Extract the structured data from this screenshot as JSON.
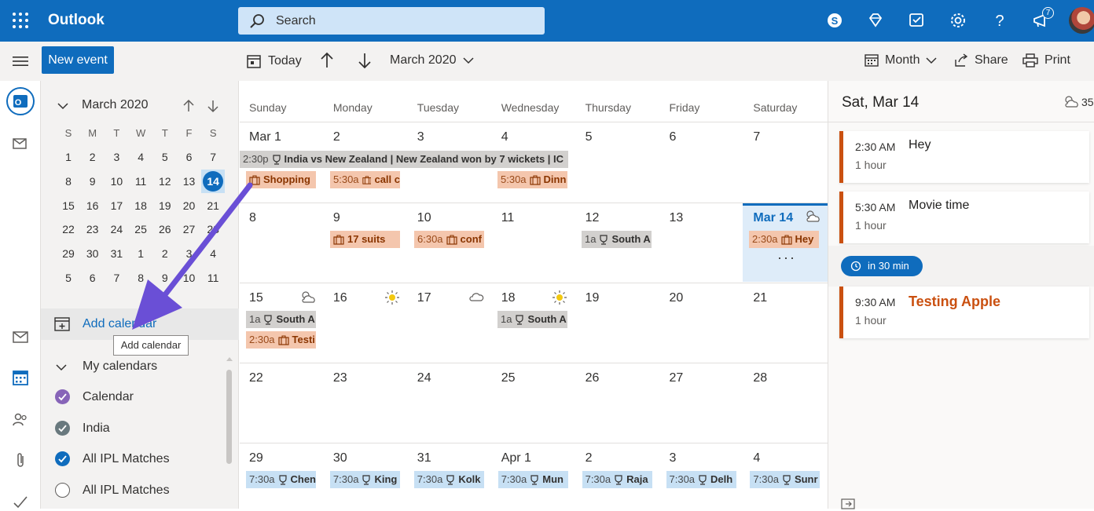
{
  "app": {
    "title": "Outlook"
  },
  "search": {
    "placeholder": "Search"
  },
  "notifications": {
    "count": "7"
  },
  "toolbar": {
    "new_event_label": "New event",
    "today_label": "Today",
    "current_period": "March 2020",
    "view_label": "Month",
    "share_label": "Share",
    "print_label": "Print"
  },
  "mini_calendar": {
    "title": "March 2020",
    "weekday_letters": [
      "S",
      "M",
      "T",
      "W",
      "T",
      "F",
      "S"
    ],
    "weeks": [
      [
        "1",
        "2",
        "3",
        "4",
        "5",
        "6",
        "7"
      ],
      [
        "8",
        "9",
        "10",
        "11",
        "12",
        "13",
        "14"
      ],
      [
        "15",
        "16",
        "17",
        "18",
        "19",
        "20",
        "21"
      ],
      [
        "22",
        "23",
        "24",
        "25",
        "26",
        "27",
        "28"
      ],
      [
        "29",
        "30",
        "31",
        "1",
        "2",
        "3",
        "4"
      ],
      [
        "5",
        "6",
        "7",
        "8",
        "9",
        "10",
        "11"
      ]
    ],
    "selected_day": "14"
  },
  "sidebar": {
    "add_calendar_label": "Add calendar",
    "tooltip": "Add calendar",
    "my_calendars_label": "My calendars",
    "calendars": [
      {
        "name": "Calendar",
        "checked": true,
        "color": "#8764b8"
      },
      {
        "name": "India",
        "checked": true,
        "color": "#69797e"
      },
      {
        "name": "All IPL Matches",
        "checked": true,
        "color": "#0f6cbd"
      },
      {
        "name": "All IPL Matches",
        "checked": false,
        "color": "#605e5c"
      }
    ]
  },
  "month_view": {
    "weekdays": [
      "Sunday",
      "Monday",
      "Tuesday",
      "Wednesday",
      "Thursday",
      "Friday",
      "Saturday"
    ],
    "weeks": [
      [
        "Mar 1",
        "2",
        "3",
        "4",
        "5",
        "6",
        "7"
      ],
      [
        "8",
        "9",
        "10",
        "11",
        "12",
        "13",
        "Mar 14"
      ],
      [
        "15",
        "16",
        "17",
        "18",
        "19",
        "20",
        "21"
      ],
      [
        "22",
        "23",
        "24",
        "25",
        "26",
        "27",
        "28"
      ],
      [
        "29",
        "30",
        "31",
        "Apr 1",
        "2",
        "3",
        "4"
      ]
    ],
    "today_label": "Mar 14",
    "more_indicator": "···",
    "events": {
      "w1_banner": {
        "time": "2:30p",
        "title": "India vs New Zealand | New Zealand won by 7 wickets | IC"
      },
      "w1_sun": {
        "title": "Shopping"
      },
      "w1_mon": {
        "time": "5:30a",
        "title": "call c"
      },
      "w1_wed": {
        "time": "5:30a",
        "title": "Dinn"
      },
      "w2_mon": {
        "title": "17 suits"
      },
      "w2_tue": {
        "time": "6:30a",
        "title": "conf"
      },
      "w2_thu": {
        "time": "1a",
        "title": "South A"
      },
      "w2_sat": {
        "time": "2:30a",
        "title": "Hey"
      },
      "w3_sun_1": {
        "time": "1a",
        "title": "South A"
      },
      "w3_sun_2": {
        "time": "2:30a",
        "title": "Testi"
      },
      "w3_wed": {
        "time": "1a",
        "title": "South A"
      },
      "w5": [
        {
          "time": "7:30a",
          "title": "Chen"
        },
        {
          "time": "7:30a",
          "title": "King"
        },
        {
          "time": "7:30a",
          "title": "Kolk"
        },
        {
          "time": "7:30a",
          "title": "Mun"
        },
        {
          "time": "7:30a",
          "title": "Raja"
        },
        {
          "time": "7:30a",
          "title": "Delh"
        },
        {
          "time": "7:30a",
          "title": "Sunr"
        }
      ]
    }
  },
  "agenda": {
    "date_title": "Sat, Mar 14",
    "weather_temp": "35",
    "events": [
      {
        "time": "2:30 AM",
        "duration": "1 hour",
        "title": "Hey"
      },
      {
        "time": "5:30 AM",
        "duration": "1 hour",
        "title": "Movie time"
      },
      {
        "time": "9:30 AM",
        "duration": "1 hour",
        "title": "Testing Apple"
      }
    ],
    "upcoming_pill": "in 30 min"
  }
}
